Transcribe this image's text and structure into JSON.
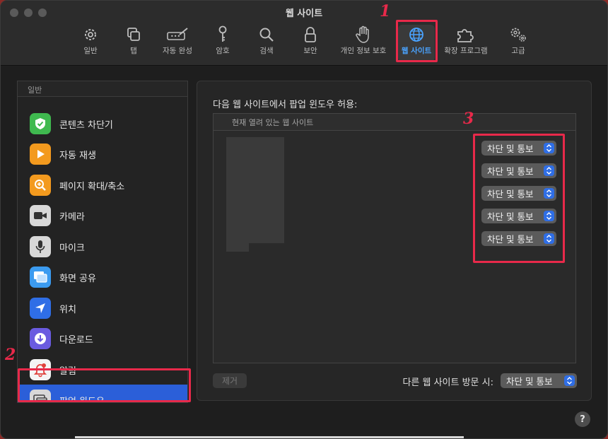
{
  "window": {
    "title": "웹 사이트"
  },
  "toolbar": {
    "items": [
      {
        "label": "일반",
        "icon": "gear-icon"
      },
      {
        "label": "탭",
        "icon": "tabs-icon"
      },
      {
        "label": "자동 완성",
        "icon": "autofill-pen-icon"
      },
      {
        "label": "암호",
        "icon": "key-icon"
      },
      {
        "label": "검색",
        "icon": "magnifier-icon"
      },
      {
        "label": "보안",
        "icon": "lock-icon"
      },
      {
        "label": "개인 정보 보호",
        "icon": "hand-icon"
      },
      {
        "label": "웹 사이트",
        "icon": "globe-icon",
        "active": true
      },
      {
        "label": "확장 프로그램",
        "icon": "puzzle-icon"
      },
      {
        "label": "고급",
        "icon": "gears-icon"
      }
    ]
  },
  "sidebar": {
    "header": "일반",
    "items": [
      {
        "label": "콘텐츠 차단기",
        "icon": "shield-check-icon",
        "color": "#3fb94f"
      },
      {
        "label": "자동 재생",
        "icon": "play-icon",
        "color": "#f39a1e"
      },
      {
        "label": "페이지 확대/축소",
        "icon": "zoom-icon",
        "color": "#f39a1e"
      },
      {
        "label": "카메라",
        "icon": "camera-icon",
        "color": "#d8d8d8"
      },
      {
        "label": "마이크",
        "icon": "microphone-icon",
        "color": "#d8d8d8"
      },
      {
        "label": "화면 공유",
        "icon": "screen-share-icon",
        "color": "#3b9bf0"
      },
      {
        "label": "위치",
        "icon": "location-arrow-icon",
        "color": "#2f6ee6"
      },
      {
        "label": "다운로드",
        "icon": "download-icon",
        "color": "#6a5be0"
      },
      {
        "label": "알림",
        "icon": "bell-icon",
        "color": "#f4f4f4"
      },
      {
        "label": "팝업 윈도우",
        "icon": "popup-window-icon",
        "color": "#d8d8d8",
        "selected": true
      }
    ]
  },
  "panel": {
    "title": "다음 웹 사이트에서 팝업 윈도우 허용:",
    "column_header": "현재 열려 있는 웹 사이트",
    "rows": [
      {
        "value": "차단 및 통보"
      },
      {
        "value": "차단 및 통보"
      },
      {
        "value": "차단 및 통보"
      },
      {
        "value": "차단 및 통보"
      },
      {
        "value": "차단 및 통보"
      }
    ],
    "remove_button": "제거",
    "other_sites_label": "다른 웹 사이트 방문 시:",
    "other_sites_value": "차단 및 통보"
  },
  "annotations": {
    "one": "1",
    "two": "2",
    "three": "3"
  },
  "help": "?",
  "colors": {
    "accent": "#2b5fd9",
    "highlight": "#e8294a",
    "active_label": "#4aa3ff"
  }
}
